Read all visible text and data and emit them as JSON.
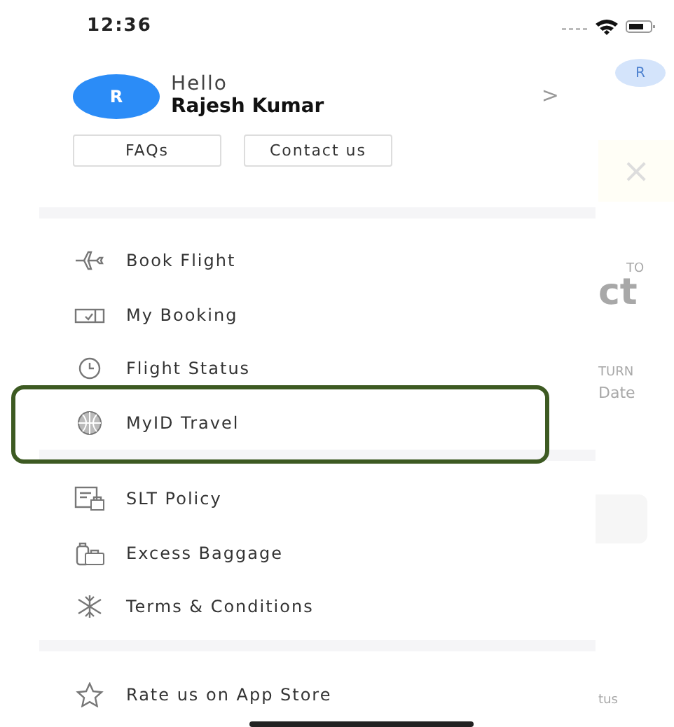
{
  "status_bar": {
    "time": "12:36"
  },
  "profile": {
    "avatar_letter": "R",
    "greeting": "Hello",
    "name": "Rajesh Kumar",
    "chevron": ">"
  },
  "quick_buttons": [
    "FAQs",
    "Contact us"
  ],
  "menu_sections": [
    {
      "items": [
        {
          "label": "Book Flight",
          "kind": "plane",
          "highlighted": false
        },
        {
          "label": "My Booking",
          "kind": "ticket",
          "highlighted": false
        },
        {
          "label": "Flight Status",
          "kind": "clock",
          "highlighted": false
        },
        {
          "label": "MyID Travel",
          "kind": "globe",
          "highlighted": true
        }
      ]
    },
    {
      "items": [
        {
          "label": "SLT Policy",
          "kind": "policy",
          "highlighted": false
        },
        {
          "label": "Excess Baggage",
          "kind": "baggage",
          "highlighted": false
        },
        {
          "label": "Terms & Conditions",
          "kind": "terms",
          "highlighted": false
        }
      ]
    },
    {
      "items": [
        {
          "label": "Rate us on App Store",
          "kind": "star",
          "highlighted": false
        }
      ]
    }
  ],
  "background_page": {
    "avatar_letter": "R",
    "close": "×",
    "to_label": "TO",
    "city_fragment": "ct",
    "return_label": "TURN",
    "date_fragment": "Date",
    "status_fragment": "tus"
  }
}
